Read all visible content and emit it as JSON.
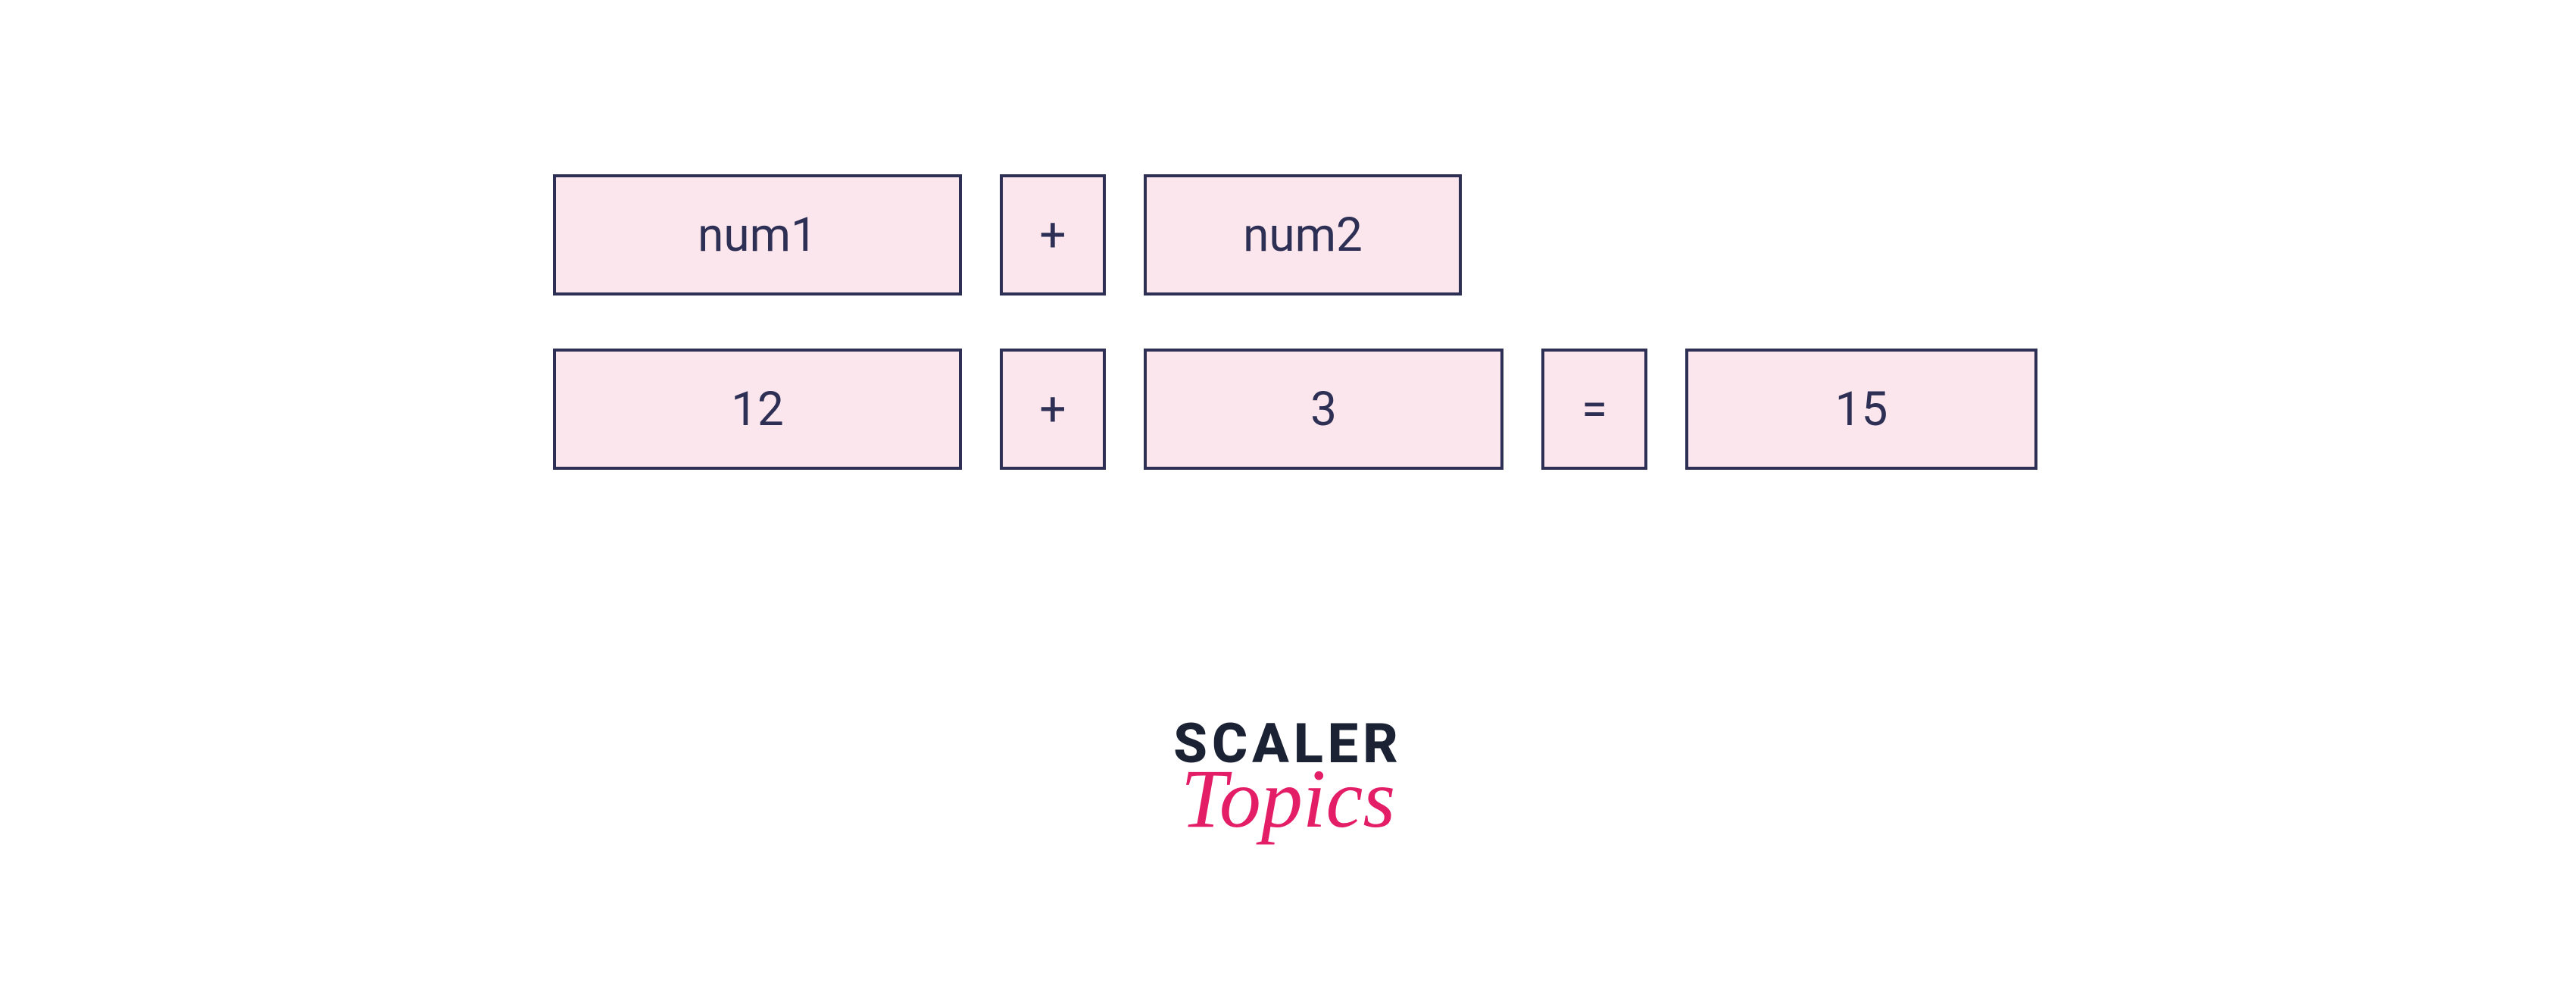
{
  "diagram": {
    "row1": {
      "operand1_label": "num1",
      "operator": "+",
      "operand2_label": "num2"
    },
    "row2": {
      "operand1_value": "12",
      "operator": "+",
      "operand2_value": "3",
      "equals": "=",
      "result": "15"
    }
  },
  "logo": {
    "line1": "SCALER",
    "line2": "Topics"
  },
  "colors": {
    "box_fill": "#fce6ed",
    "box_border": "#2d2f55",
    "text": "#2d2f55",
    "logo_dark": "#1b2233",
    "logo_accent": "#e31e67"
  }
}
